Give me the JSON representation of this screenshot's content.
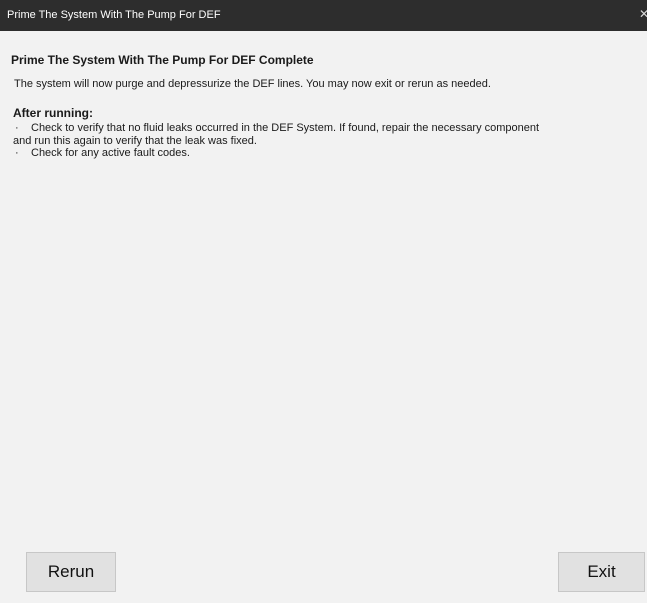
{
  "window": {
    "title": "Prime The System With The Pump For DEF",
    "close_glyph": "✕"
  },
  "content": {
    "heading": "Prime The System With The Pump For DEF Complete",
    "intro": "The system will now purge and depressurize the DEF lines. You may now exit or rerun as needed.",
    "after_running_title": "After running:",
    "bullet_glyph": "·",
    "bullets": [
      {
        "line1": "Check to verify that no fluid leaks occurred in the DEF System. If found, repair the necessary component",
        "line2": "and run this again to verify that the leak was fixed."
      },
      {
        "line1": "Check for any active fault codes."
      }
    ]
  },
  "buttons": {
    "rerun_label": "Rerun",
    "exit_label": "Exit"
  },
  "colors": {
    "titlebar": "#2d2d2d",
    "background": "#f2f2f2",
    "button": "#e1e1e1"
  }
}
